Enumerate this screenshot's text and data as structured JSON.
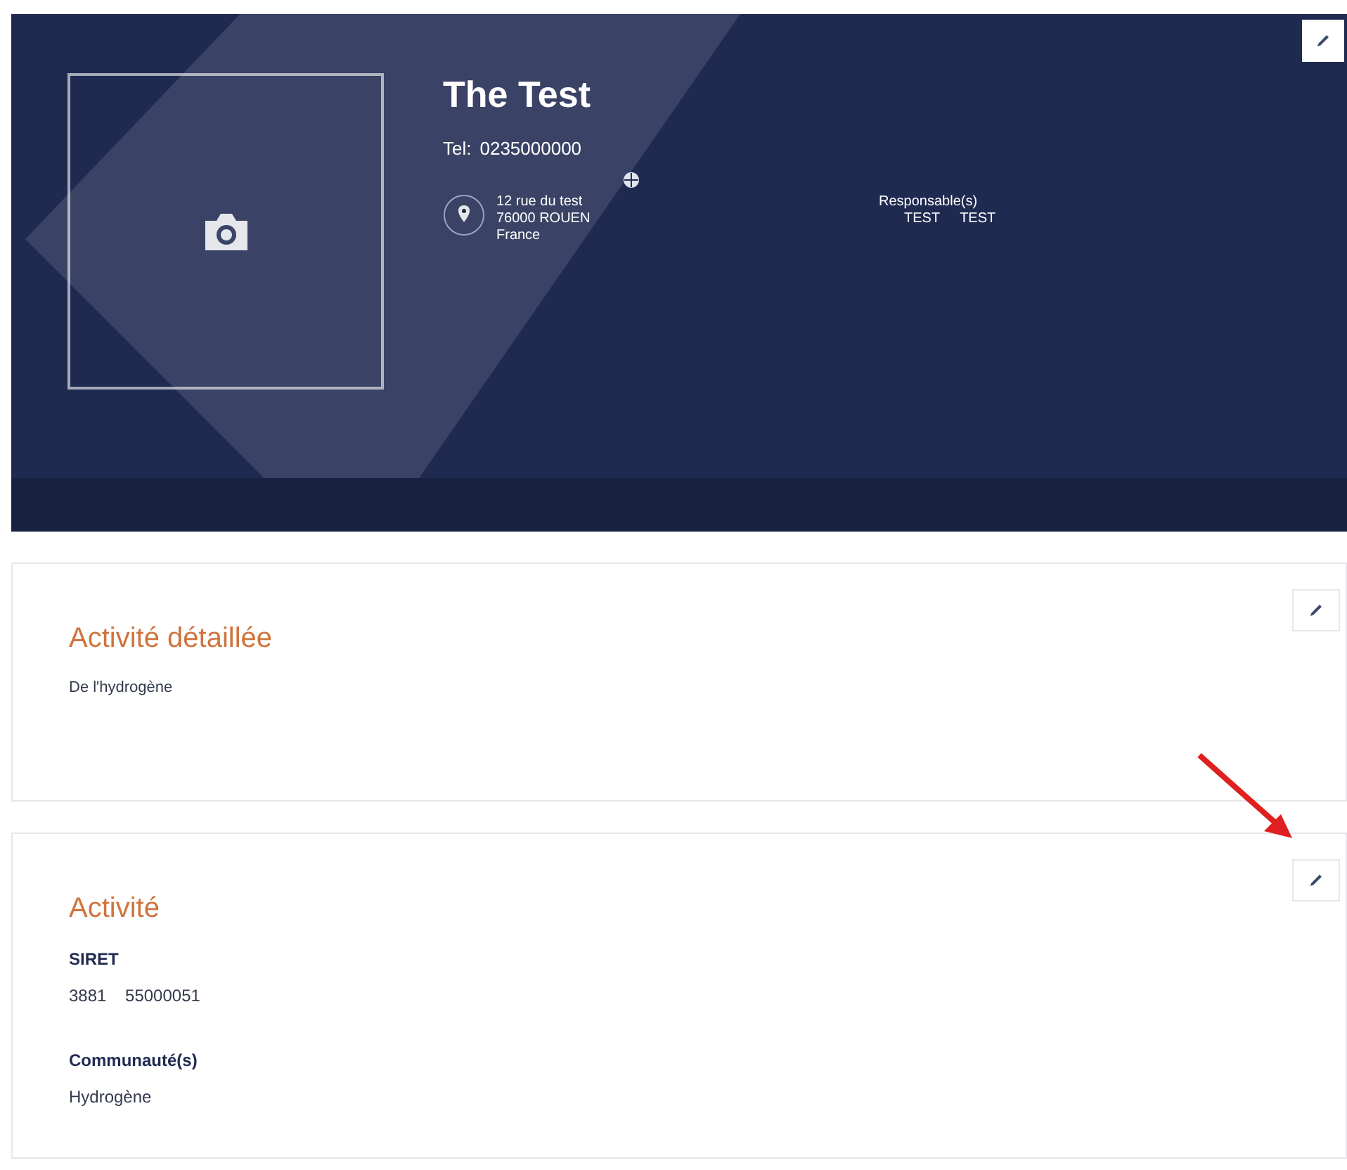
{
  "header": {
    "name": "The Test",
    "phone_label": "Tel:",
    "phone": "0235000000",
    "address": [
      "12 rue du test",
      "76000 ROUEN",
      "France"
    ],
    "managers_label": "Responsable(s)",
    "managers": [
      "TEST",
      "TEST"
    ]
  },
  "sections": [
    {
      "title": "Activité détaillée",
      "fields": [
        {
          "kind": "text",
          "value": "De l'hydrogène"
        }
      ],
      "highlighted": false
    },
    {
      "title": "Activité",
      "fields": [
        {
          "kind": "labeled",
          "label": "SIRET",
          "value": "3881    55000051"
        },
        {
          "kind": "labeled",
          "label": "Communauté(s)",
          "value": "Hydrogène"
        }
      ],
      "highlighted": true
    }
  ]
}
